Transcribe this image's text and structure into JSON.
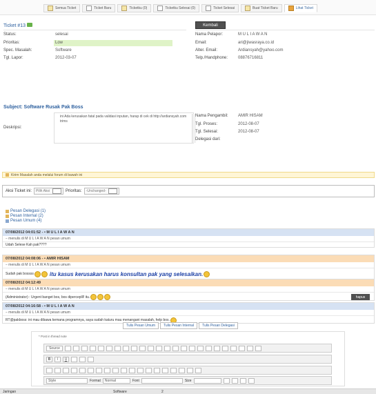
{
  "tabs": [
    {
      "label": "Semua Ticket",
      "icon": "folder-icon"
    },
    {
      "label": "Ticket Baru",
      "icon": "document-icon"
    },
    {
      "label": "Ticketku (0)",
      "icon": "folder-icon"
    },
    {
      "label": "Ticketku Selesai (0)",
      "icon": "document-icon"
    },
    {
      "label": "Ticket Selesai",
      "icon": "document-icon"
    },
    {
      "label": "Buat Ticket Baru",
      "icon": "folder-icon"
    },
    {
      "label": "Lihat Ticket",
      "icon": "star-icon",
      "active": true
    }
  ],
  "ticket": {
    "title": "Ticket #13",
    "back_label": "Kembali",
    "left": [
      {
        "label": "Status:",
        "value": "selesai"
      },
      {
        "label": "Prioritas:",
        "value": "Low"
      },
      {
        "label": "Spec. Masalah:",
        "value": "Software"
      },
      {
        "label": "Tgl. Lapor:",
        "value": "2012-03-07"
      }
    ],
    "right": [
      {
        "label": "Nama Pelapor:",
        "value": "M U L I A W A N"
      },
      {
        "label": "Email:",
        "value": "ari@jiwasraya.co.id"
      },
      {
        "label": "Alter. Email:",
        "value": "Ardiansyah@yahoo.com"
      },
      {
        "label": "Telp./Handphone:",
        "value": "08876716811"
      }
    ],
    "subject": "Subject: Software Rusak Pak Boss",
    "desc_label": "Deskripsi:",
    "desc_text": "ini Ada kerusakan fatal pada validasi inputan, harap di cek di http://ardiansyah.com trims",
    "right2": [
      {
        "label": "Nama Pengambil:",
        "value": "AMIR HISAM"
      },
      {
        "label": "Tgl. Proses:",
        "value": "2012-08-07"
      },
      {
        "label": "Tgl. Selesai:",
        "value": "2012-08-07"
      },
      {
        "label": "Delegasi dari:",
        "value": ""
      }
    ]
  },
  "notice": "Kirim Masalah anda melalui forum di bawah ini",
  "action": {
    "label": "Aksi Ticket ini:",
    "select_value": "Pilih Aksi",
    "priority_label": "Prioritas:",
    "priority_value": "-Unchanged-"
  },
  "messages": {
    "delegasi": "Pesan Delegasi (1)",
    "internal": "Pesan Internal (2)",
    "umum": "Pesan Umum (4)"
  },
  "posts": [
    {
      "header": "07/08/2012 04:01:52 - • M U L I A W A N",
      "color": "blue",
      "sub": "− menulis di M U L I A W A N pesan umum",
      "body": "Udah Selese Kah pak????",
      "extra": ""
    },
    {
      "header": "07/08/2012 04:08:06 - • AMIR HISAM",
      "color": "orange",
      "sub": "− menulis di M U L I A W A N pesan umum",
      "body": "Sudah pak bossss",
      "extra": "itu kasus kerusakan harus konsultan pak yang selesaikan."
    },
    {
      "header": "07/08/2012 04:12:49",
      "color": "orange",
      "sub": "− menulis di M U L I A W A N pesan umum",
      "body": "(Administrator) : Urgent banget bos, bos diperceplll! itu.",
      "extra": ""
    },
    {
      "header": "07/08/2012 04:16:58 - • M U L I A W A N",
      "color": "blue",
      "sub": "− menulis di M U L I A W A N pesan umum",
      "body": "RT@pakboss: ini mau dibawa kemana programnya, saya sudah katuru mau menangani masalah, help bos.",
      "extra": ""
    }
  ],
  "hapus_label": "hapus",
  "comment_tabs": [
    "Tulis Pesan Umum",
    "Tulis Pesan Internal",
    "Tulis Pesan Delegasi"
  ],
  "editor": {
    "label": "* Post in thread note",
    "source_label": "Source",
    "style_label": "Style",
    "format_label": "Format",
    "format_value": "Normal",
    "font_label": "Font",
    "size_label": "Size"
  },
  "statusbar": [
    "Jaringan",
    "",
    "Software",
    "2"
  ]
}
